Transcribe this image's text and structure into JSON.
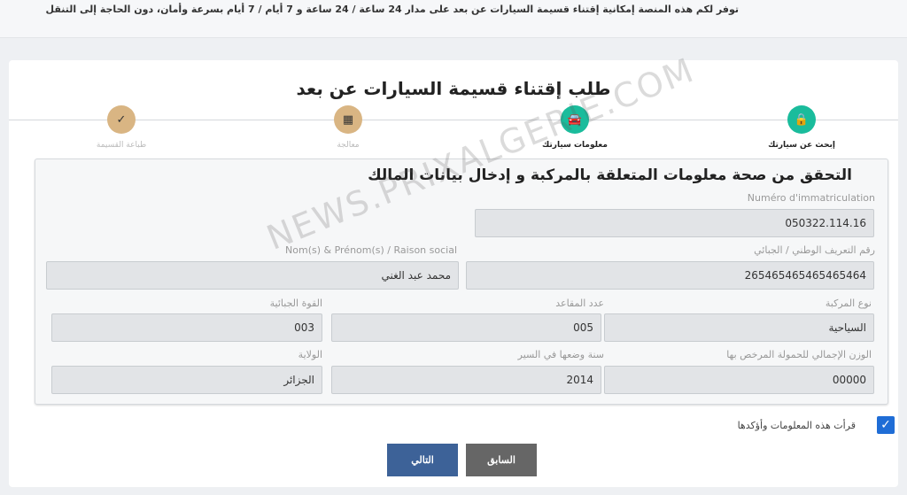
{
  "banner": {
    "text": "توفر لكم هذه المنصة إمكانية إقتناء قسيمة السيارات عن بعد على مدار 24 ساعة / 24 ساعة و 7 أيام / 7 أيام بسرعة وأمان، دون الحاجة إلى التنقل"
  },
  "page": {
    "title": "طلب إقتناء قسيمة السيارات عن بعد"
  },
  "steps": [
    {
      "label": "إبحث عن سيارتك",
      "icon": "lock-icon",
      "glyph": "🔒",
      "color": "#1abc9c",
      "active": true
    },
    {
      "label": "معلومات سيارتك",
      "icon": "car-icon",
      "glyph": "🚘",
      "color": "#1abc9c",
      "active": true
    },
    {
      "label": "معالجة",
      "icon": "calculator-icon",
      "glyph": "▦",
      "color": "#d9b583",
      "active": false
    },
    {
      "label": "طباعة القسيمة",
      "icon": "check-icon",
      "glyph": "✓",
      "color": "#d9b583",
      "active": false
    }
  ],
  "panel": {
    "title": "التحقق من صحة معلومات المتعلقة بالمركبة و إدخال بيانات المالك",
    "registration": {
      "label": "Numéro d'immatriculation",
      "value": "050322.114.16"
    },
    "nin": {
      "label": "رقم التعريف الوطني / الجبائي",
      "value": "265465465465465464"
    },
    "owner": {
      "label": "Nom(s) & Prénom(s) / Raison social",
      "value": "محمد عبد الغني"
    },
    "vehicle_type": {
      "label": "نوع المركبة",
      "value": "السياحية"
    },
    "seats": {
      "label": "عدد المقاعد",
      "value": "005"
    },
    "fiscal_power": {
      "label": "القوة الجبائية",
      "value": "003"
    },
    "gross_weight": {
      "label": "الوزن الإجمالي للحمولة المرخص بها",
      "value": "00000"
    },
    "year": {
      "label": "سنة وضعها في السير",
      "value": "2014"
    },
    "wilaya": {
      "label": "الولاية",
      "value": "الجزائر"
    }
  },
  "watermark": "NEWS.PRIXALGERIE.COM",
  "confirm": {
    "label": "قرأت هذه المعلومات وأؤكدها",
    "checked": true
  },
  "buttons": {
    "next": "التالي",
    "prev": "السابق"
  }
}
